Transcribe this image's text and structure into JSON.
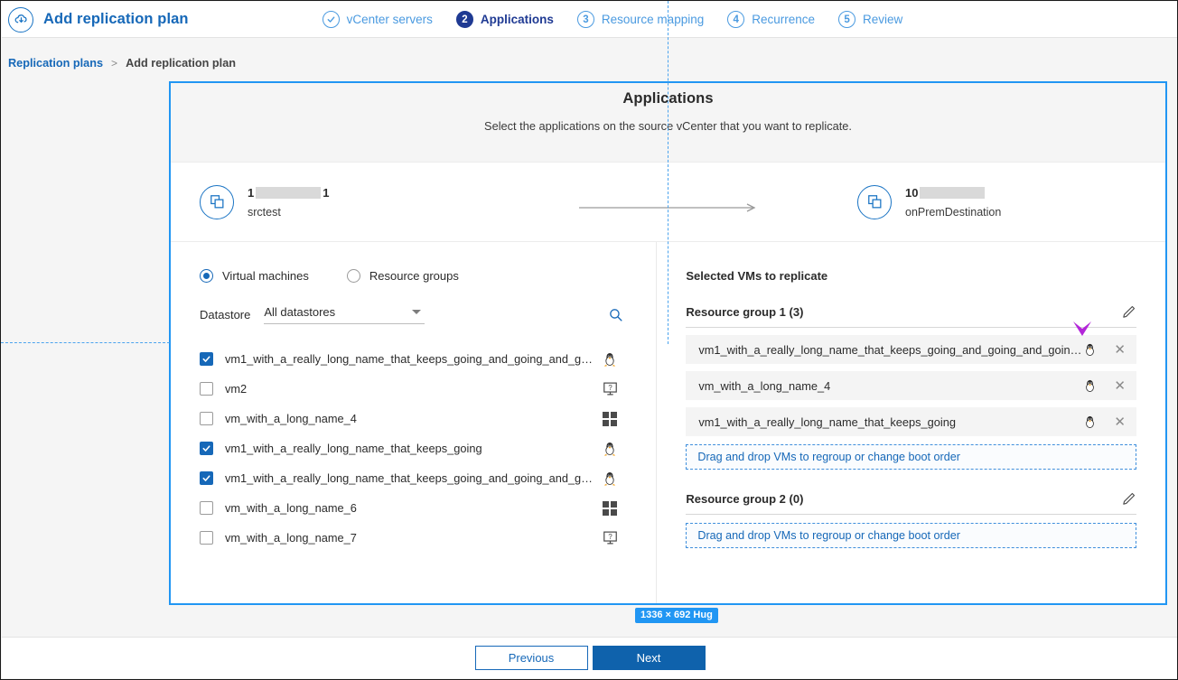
{
  "app": {
    "brand_icon": "cloud-replication-icon",
    "title": "Add replication plan"
  },
  "wizard": {
    "steps": [
      {
        "badge": "✓",
        "label": "vCenter servers",
        "state": "done"
      },
      {
        "badge": "2",
        "label": "Applications",
        "state": "active"
      },
      {
        "badge": "3",
        "label": "Resource mapping",
        "state": "todo"
      },
      {
        "badge": "4",
        "label": "Recurrence",
        "state": "todo"
      },
      {
        "badge": "5",
        "label": "Review",
        "state": "todo"
      }
    ]
  },
  "breadcrumb": {
    "link": "Replication plans",
    "separator": ">",
    "current": "Add replication plan"
  },
  "card": {
    "title": "Applications",
    "subtitle": "Select the applications on the source vCenter that you want to replicate."
  },
  "endpoints": {
    "source": {
      "icon": "vcenter-icon",
      "name_prefix": "1",
      "name_suffix": "1",
      "subtitle": "srctest"
    },
    "arrow_icon": "arrow-right-icon",
    "destination": {
      "icon": "vcenter-icon",
      "name_prefix": "10",
      "name_suffix": "",
      "subtitle": "onPremDestination"
    }
  },
  "left_pane": {
    "radios": [
      {
        "label": "Virtual machines",
        "selected": true
      },
      {
        "label": "Resource groups",
        "selected": false
      }
    ],
    "filter_label": "Datastore",
    "filter_value": "All datastores",
    "search_icon": "search-icon",
    "vms": [
      {
        "name": "vm1_with_a_really_long_name_that_keeps_going_and_going_and_g…",
        "checked": true,
        "os": "linux"
      },
      {
        "name": "vm2",
        "checked": false,
        "os": "unknown"
      },
      {
        "name": "vm_with_a_long_name_4",
        "checked": false,
        "os": "windows"
      },
      {
        "name": "vm1_with_a_really_long_name_that_keeps_going",
        "checked": true,
        "os": "linux"
      },
      {
        "name": "vm1_with_a_really_long_name_that_keeps_going_and_going_and_g…",
        "checked": true,
        "os": "linux"
      },
      {
        "name": "vm_with_a_long_name_6",
        "checked": false,
        "os": "windows"
      },
      {
        "name": "vm_with_a_long_name_7",
        "checked": false,
        "os": "unknown"
      }
    ]
  },
  "right_pane": {
    "title": "Selected VMs to replicate",
    "dropzone_text": "Drag and drop VMs to regroup or change boot order",
    "groups": [
      {
        "name": "Resource group 1 (3)",
        "edit_icon": "pencil-icon",
        "items": [
          {
            "name": "vm1_with_a_really_long_name_that_keeps_going_and_going_and_goin…",
            "os": "linux",
            "remove_icon": "close-icon"
          },
          {
            "name": "vm_with_a_long_name_4",
            "os": "linux",
            "remove_icon": "close-icon"
          },
          {
            "name": "vm1_with_a_really_long_name_that_keeps_going",
            "os": "linux",
            "remove_icon": "close-icon"
          }
        ]
      },
      {
        "name": "Resource group 2 (0)",
        "edit_icon": "pencil-icon",
        "items": []
      }
    ]
  },
  "overlay": {
    "size_badge": "1336 × 692 Hug",
    "cursor_color": "#b326d9",
    "selection_color": "#2196f3"
  },
  "footer": {
    "previous_label": "Previous",
    "next_label": "Next"
  }
}
